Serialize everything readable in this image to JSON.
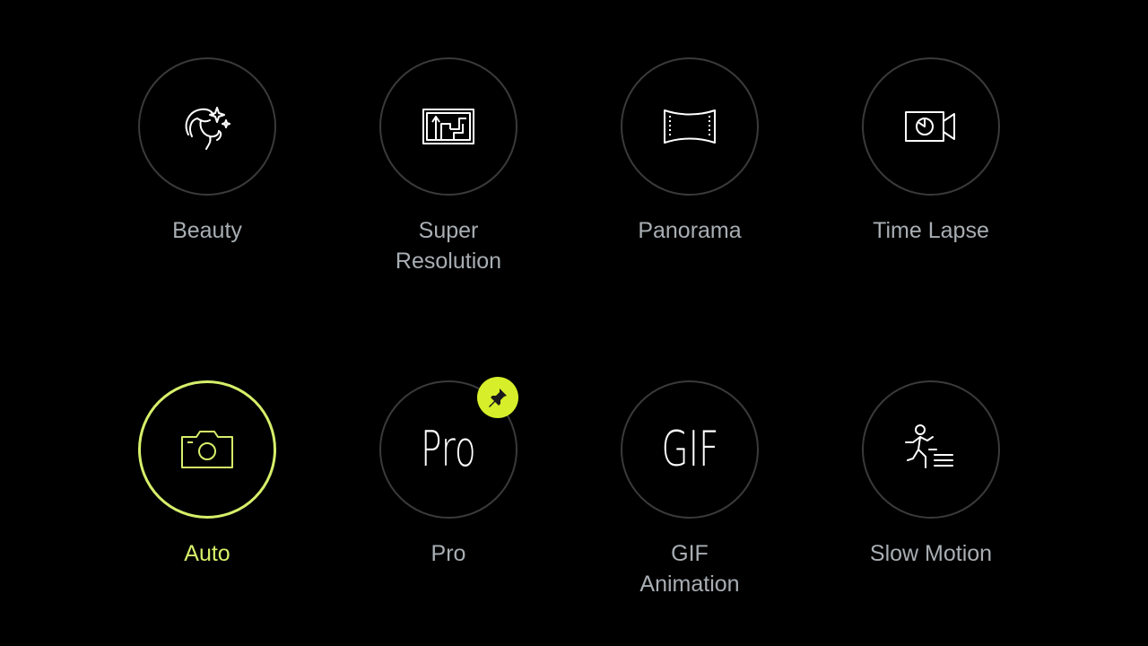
{
  "colors": {
    "background": "#000000",
    "ring": "#3a3a3a",
    "active": "#d6ef6a",
    "label": "#a8aeb3",
    "badge": "#d6ef2a"
  },
  "modes": [
    {
      "label": "Beauty",
      "icon": "beauty-icon"
    },
    {
      "label": "Super\nResolution",
      "icon": "super-resolution-icon"
    },
    {
      "label": "Panorama",
      "icon": "panorama-icon"
    },
    {
      "label": "Time Lapse",
      "icon": "time-lapse-icon"
    },
    {
      "label": "Auto",
      "icon": "camera-icon",
      "active": true
    },
    {
      "label": "Pro",
      "icon_text": "Pro",
      "icon": "pro-icon",
      "pinned": true
    },
    {
      "label": "GIF\nAnimation",
      "icon_text": "GIF",
      "icon": "gif-icon"
    },
    {
      "label": "Slow Motion",
      "icon": "slow-motion-icon"
    }
  ]
}
